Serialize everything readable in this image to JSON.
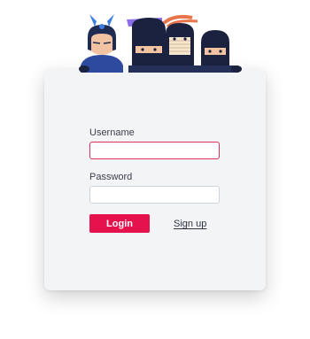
{
  "form": {
    "username_label": "Username",
    "username_value": "",
    "password_label": "Password",
    "password_value": "",
    "login_label": "Login",
    "signup_label": "Sign up"
  },
  "colors": {
    "accent": "#e5124e",
    "card_bg": "#f3f4f6",
    "focus_border": "#d9325c"
  },
  "illustration": {
    "icon": "ninja-team-mascots-icon"
  }
}
